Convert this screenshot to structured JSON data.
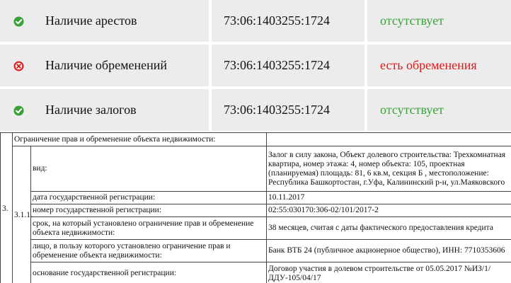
{
  "status_rows": [
    {
      "icon": "check-circle-icon",
      "label": "Наличие арестов",
      "cadastral": "73:06:1403255:1724",
      "status": "отсутствует",
      "status_color": "#3aa13a"
    },
    {
      "icon": "x-circle-icon",
      "label": "Наличие обременений",
      "cadastral": "73:06:1403255:1724",
      "status": "есть обременения",
      "status_color": "#e01818"
    },
    {
      "icon": "check-circle-icon",
      "label": "Наличие залогов",
      "cadastral": "73:06:1403255:1724",
      "status": "отсутствует",
      "status_color": "#3aa13a"
    }
  ],
  "registry": {
    "section_number": "3.",
    "subsection_number": "3.1.1.",
    "header": "Ограничение прав и обременение объекта недвижимости:",
    "rows": [
      {
        "label": "вид:",
        "value": "Залог в силу закона, Объект долевого строительства: Трехкомнатная квартира, номер этажа: 4, номер объекта: 105, проектная (планируемая) площадь: 81, 6 кв.м, секция Б , местоположение: Республика Башкортостан, г.Уфа, Калининский р-н, ул.Маяковского"
      },
      {
        "label": "дата государственной регистрации:",
        "value": "10.11.2017"
      },
      {
        "label": "номер государственной регистрации:",
        "value": "02:55:030170:306-02/101/2017-2"
      },
      {
        "label": "срок, на который установлено ограничение прав и обременение объекта недвижимости:",
        "value": "38 месяцев, считая с даты фактического предоставления кредита"
      },
      {
        "label": "лицо, в пользу которого установлено ограничение прав и обременение объекта недвижимости:",
        "value": "Банк ВТБ 24 (публичное акционерное общество), ИНН: 7710353606"
      },
      {
        "label": "основание государственной регистрации:",
        "value": "Договор участия в долевом строительстве от 05.05.2017 №ИЗ/1/ДДУ-105/04/17"
      }
    ]
  }
}
